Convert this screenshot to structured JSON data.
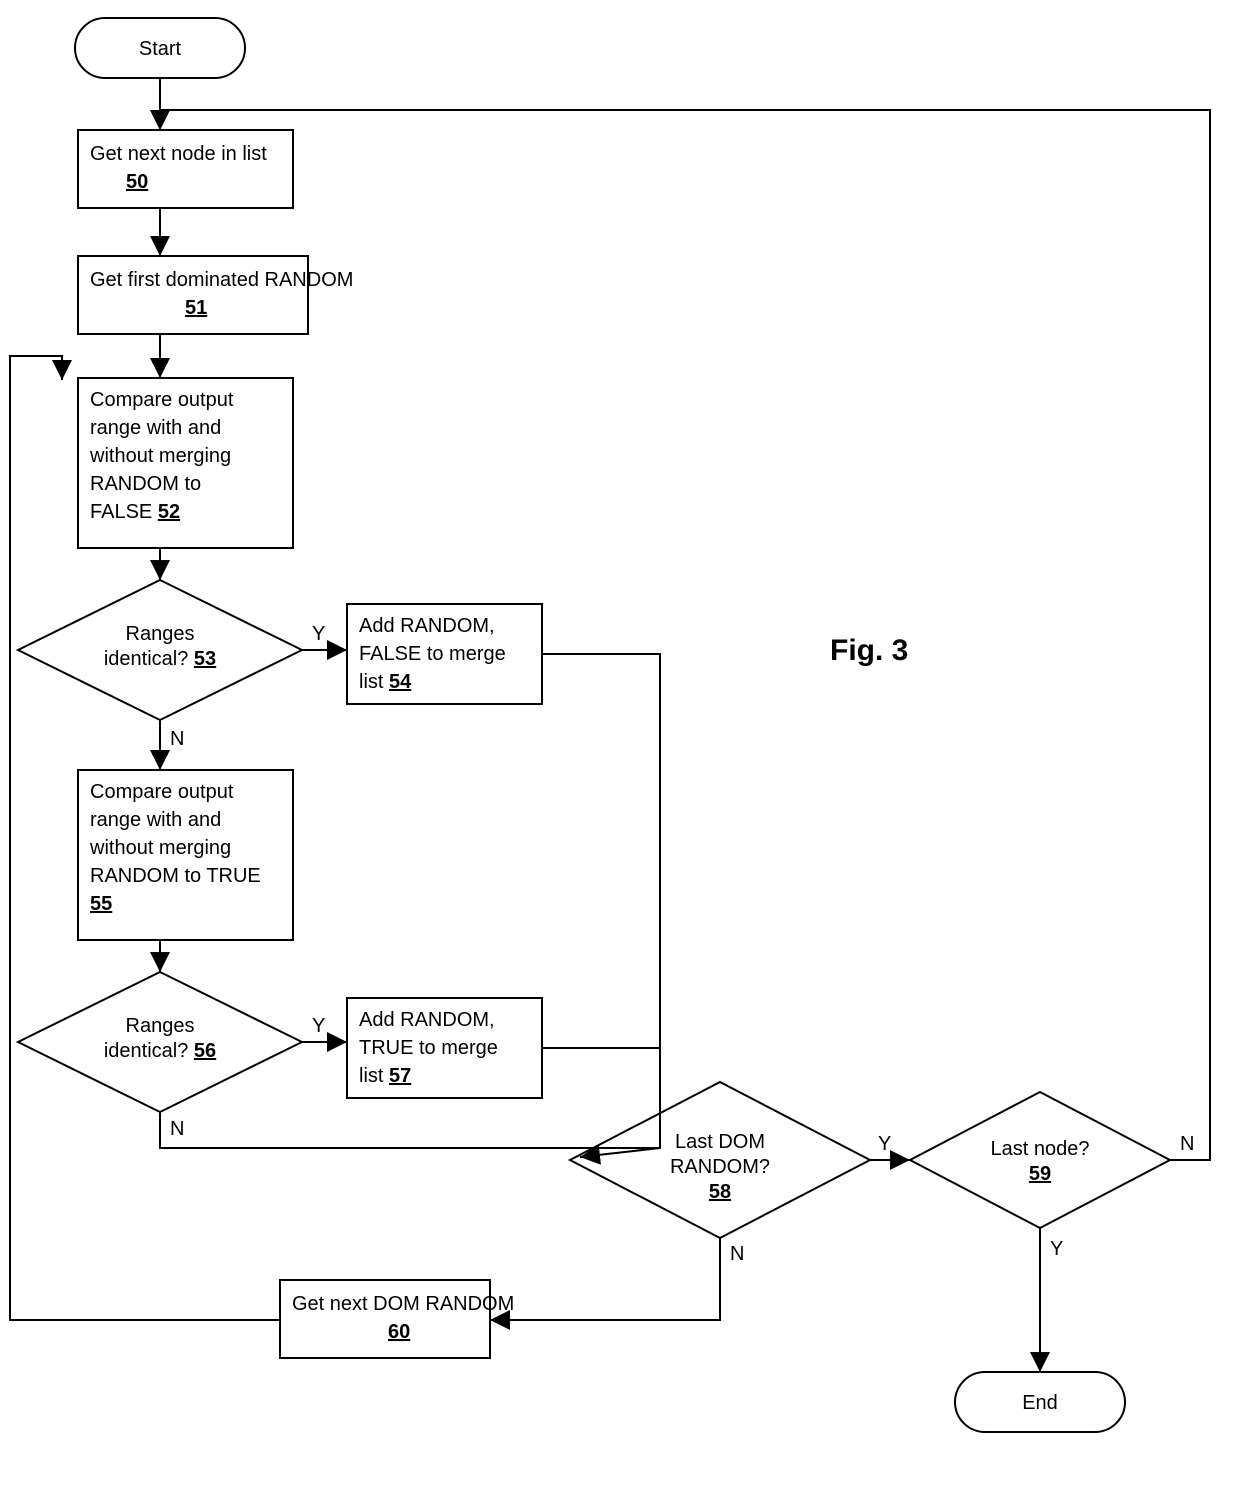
{
  "figure_label": "Fig. 3",
  "nodes": {
    "start": {
      "text": "Start"
    },
    "n50": {
      "text": "Get next node in list",
      "ref": "50"
    },
    "n51": {
      "text": "Get first dominated RANDOM",
      "ref": "51"
    },
    "n52": {
      "lines": [
        "Compare output",
        "range with and",
        "without merging",
        "RANDOM to",
        "FALSE"
      ],
      "ref": "52"
    },
    "n53": {
      "lines": [
        "Ranges",
        "identical?"
      ],
      "ref": "53"
    },
    "n54": {
      "lines": [
        "Add RANDOM,",
        "FALSE to merge",
        "list"
      ],
      "ref": "54"
    },
    "n55": {
      "lines": [
        "Compare output",
        "range with and",
        "without merging",
        "RANDOM to TRUE"
      ],
      "ref": "55"
    },
    "n56": {
      "lines": [
        "Ranges",
        "identical?"
      ],
      "ref": "56"
    },
    "n57": {
      "lines": [
        "Add RANDOM,",
        "TRUE to merge",
        "list"
      ],
      "ref": "57"
    },
    "n58": {
      "lines": [
        "Last DOM",
        "RANDOM?"
      ],
      "ref": "58"
    },
    "n59": {
      "text": "Last node?",
      "ref": "59"
    },
    "n60": {
      "text": "Get next DOM RANDOM",
      "ref": "60"
    },
    "end": {
      "text": "End"
    }
  },
  "edge_labels": {
    "yes": "Y",
    "no": "N"
  }
}
